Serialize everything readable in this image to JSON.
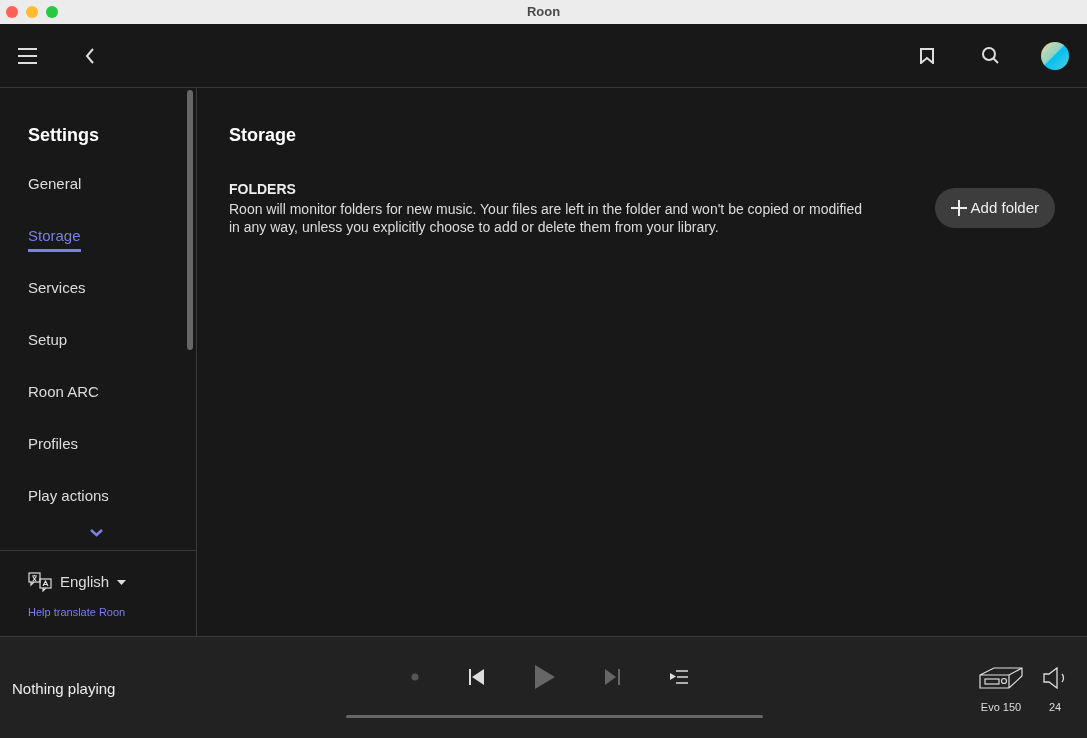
{
  "window": {
    "title": "Roon"
  },
  "sidebar": {
    "title": "Settings",
    "items": [
      {
        "label": "General",
        "selected": false
      },
      {
        "label": "Storage",
        "selected": true
      },
      {
        "label": "Services",
        "selected": false
      },
      {
        "label": "Setup",
        "selected": false
      },
      {
        "label": "Roon ARC",
        "selected": false
      },
      {
        "label": "Profiles",
        "selected": false
      },
      {
        "label": "Play actions",
        "selected": false
      }
    ],
    "language": "English",
    "help_link": "Help translate Roon"
  },
  "content": {
    "title": "Storage",
    "section": {
      "heading": "FOLDERS",
      "description": "Roon will monitor folders for new music. Your files are left in the folder and won't be copied or modified in any way, unless you explicitly choose to add or delete them from your library."
    },
    "add_button": "Add folder"
  },
  "player": {
    "status": "Nothing playing",
    "zone": "Evo 150",
    "volume": "24"
  }
}
